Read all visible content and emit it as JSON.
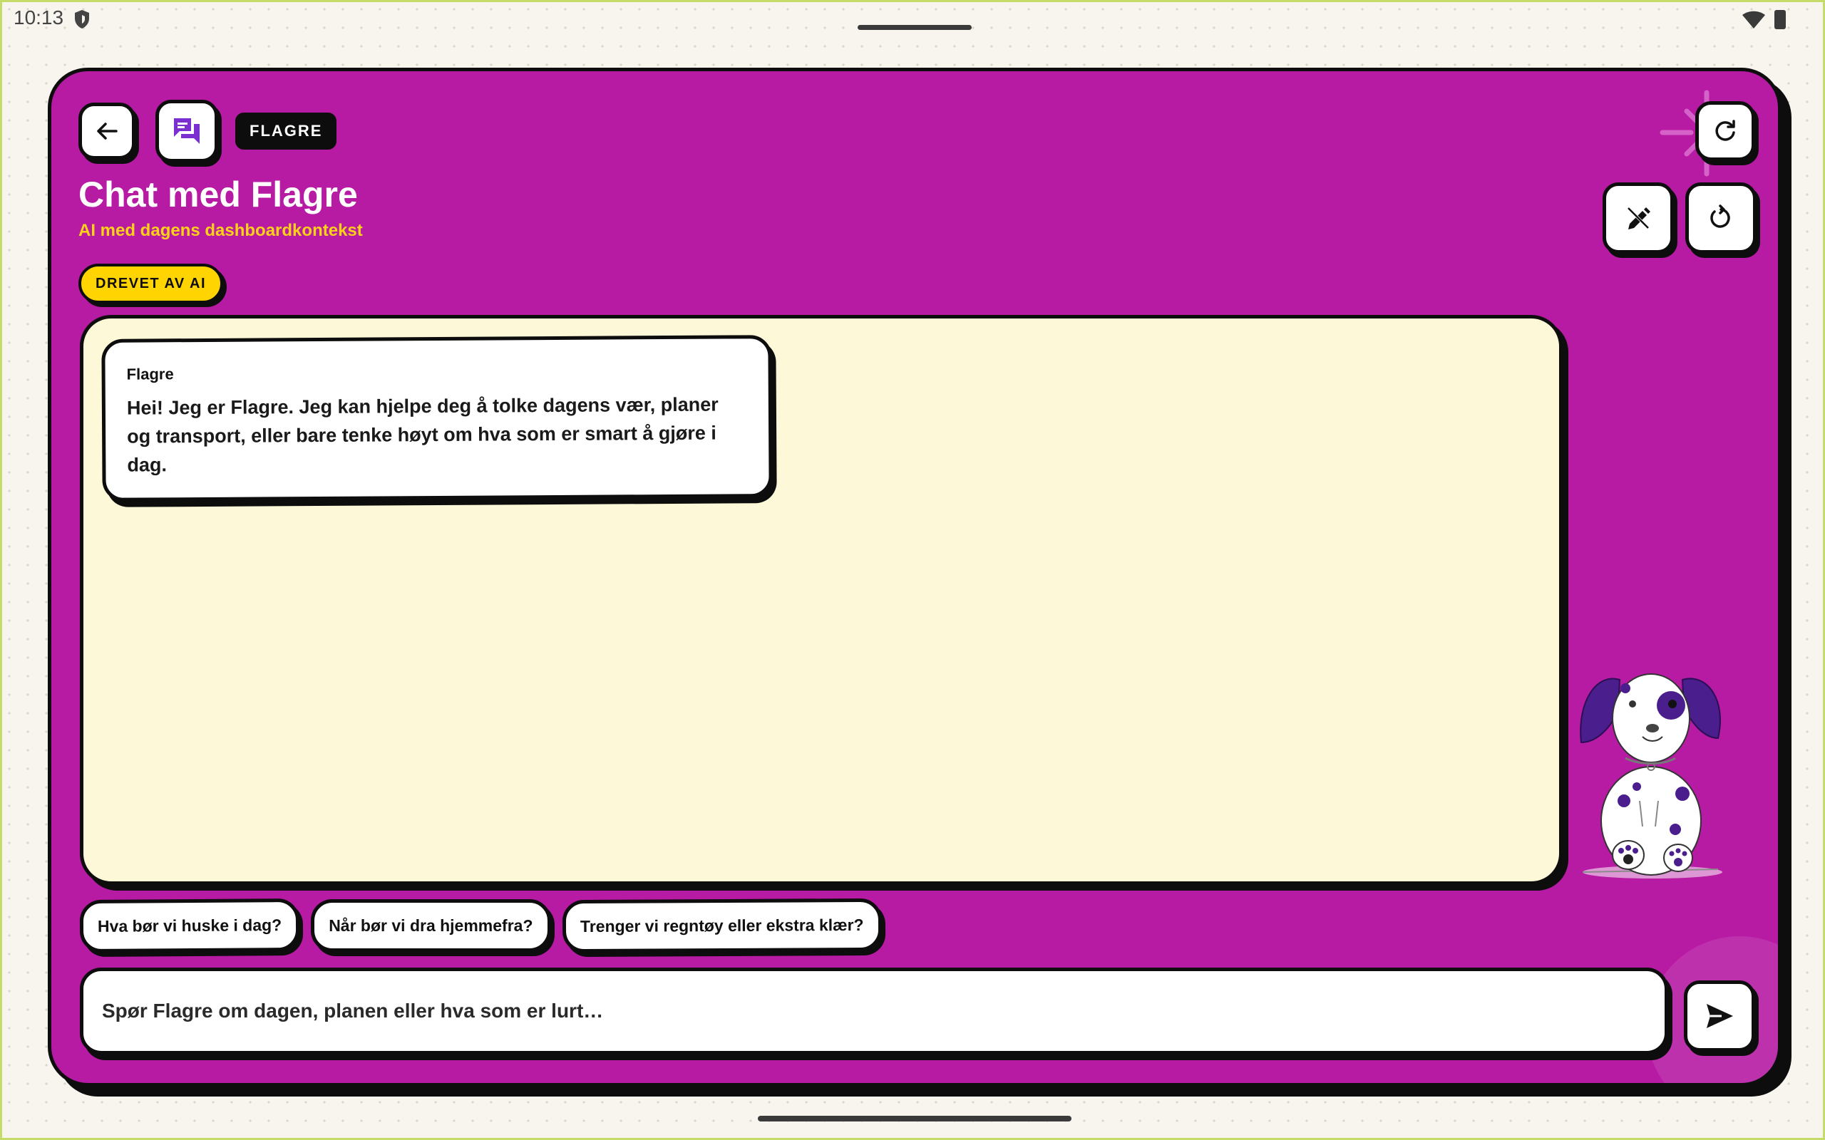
{
  "status_bar": {
    "time": "10:13"
  },
  "header": {
    "back_icon": "arrow-left-icon",
    "chat_icon": "chat-bubbles-icon",
    "tag": "FLAGRE",
    "title": "Chat med Flagre",
    "subtitle": "AI med dagens dashboardkontekst",
    "ai_badge": "DREVET AV AI",
    "refresh_icon": "refresh-icon",
    "edit_icon": "edit-pencil-icon",
    "reset_icon": "reset-icon"
  },
  "messages": [
    {
      "sender": "Flagre",
      "text": "Hei! Jeg er Flagre. Jeg kan hjelpe deg å tolke dagens vær, planer og transport, eller bare tenke høyt om hva som er smart å gjøre i dag."
    }
  ],
  "suggestions": [
    {
      "label": "Hva bør vi huske i dag?"
    },
    {
      "label": "Når bør vi dra hjemmefra?"
    },
    {
      "label": "Trenger vi regntøy eller ekstra klær?"
    }
  ],
  "input": {
    "placeholder": "Spør Flagre om dagen, planen eller hva som er lurt…",
    "value": "",
    "send_icon": "send-icon"
  },
  "colors": {
    "card_background": "#b71aa3",
    "chat_background": "#fdf8d8",
    "subtitle": "#ffd21a",
    "badge": "#ffd400",
    "icon_accent": "#7b2fd0"
  }
}
